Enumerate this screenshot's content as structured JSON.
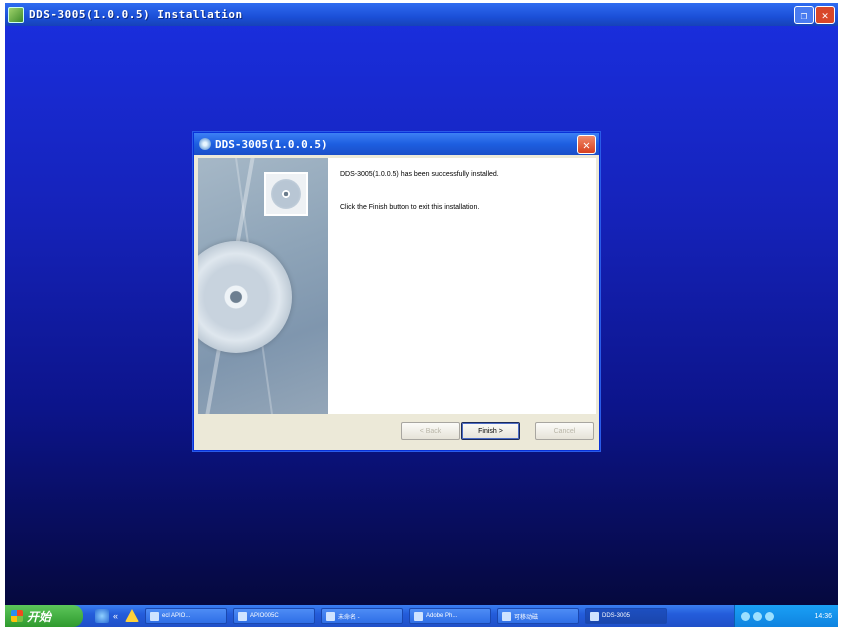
{
  "outer_window": {
    "title": "DDS-3005(1.0.0.5) Installation"
  },
  "dialog": {
    "title": "DDS-3005(1.0.0.5)",
    "message": "DDS-3005(1.0.0.5) has been successfully installed.",
    "instruction": "Click the Finish button to exit this installation.",
    "buttons": {
      "back": "< Back",
      "finish": "Finish >",
      "cancel": "Cancel"
    }
  },
  "taskbar": {
    "start_label": "开始",
    "tasks": [
      {
        "label": "ecl APIO..."
      },
      {
        "label": "APIO005C"
      },
      {
        "label": "未命名 -"
      },
      {
        "label": "Adobe Ph..."
      },
      {
        "label": "可移动磁"
      },
      {
        "label": "DDS-3005"
      }
    ],
    "clock": "14:36"
  }
}
